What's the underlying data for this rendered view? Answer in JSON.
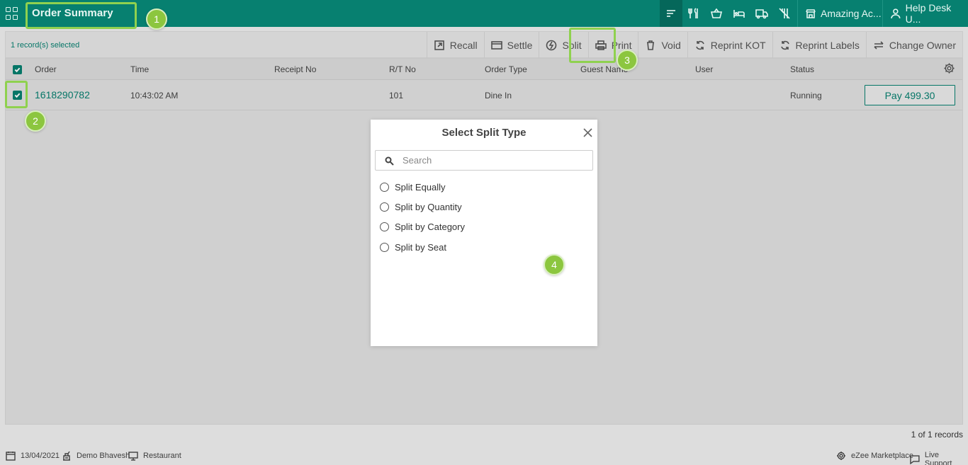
{
  "header": {
    "title": "Order Summary",
    "property_name": "Amazing Ac...",
    "user_name": "Help Desk U...",
    "icons": [
      "sort-icon",
      "restaurant-icon",
      "basket-icon",
      "bed-icon",
      "delivery-truck-icon",
      "no-service-icon"
    ]
  },
  "toolbar": {
    "selection_text": "1 record(s) selected",
    "actions": [
      {
        "label": "Recall",
        "icon": "recall-icon"
      },
      {
        "label": "Settle",
        "icon": "card-icon"
      },
      {
        "label": "Split",
        "icon": "split-icon"
      },
      {
        "label": "Print",
        "icon": "print-icon"
      },
      {
        "label": "Void",
        "icon": "trash-icon"
      },
      {
        "label": "Reprint KOT",
        "icon": "refresh-icon"
      },
      {
        "label": "Reprint Labels",
        "icon": "refresh-icon"
      },
      {
        "label": "Change Owner",
        "icon": "swap-icon"
      }
    ]
  },
  "table": {
    "columns": [
      "Order",
      "Time",
      "Receipt No",
      "R/T No",
      "Order Type",
      "Guest Name",
      "User",
      "Status"
    ],
    "rows": [
      {
        "order": "1618290782",
        "time": "10:43:02 AM",
        "receipt_no": "",
        "rt_no": "101",
        "order_type": "Dine In",
        "guest_name": "",
        "user": "",
        "status": "Running",
        "pay_label": "Pay 499.30",
        "selected": true
      }
    ],
    "records_text": "1 of 1 records"
  },
  "modal": {
    "title": "Select Split Type",
    "search_placeholder": "Search",
    "options": [
      "Split Equally",
      "Split by Quantity",
      "Split by Category",
      "Split by Seat"
    ]
  },
  "status_bar": {
    "date": "13/04/2021",
    "user": "Demo Bhavesh",
    "outlet": "Restaurant",
    "marketplace": "eZee Marketplace",
    "support": "Live Support"
  },
  "annotations": [
    "1",
    "2",
    "3",
    "4"
  ],
  "colors": {
    "primary": "#078070",
    "highlight": "#8fd14f",
    "badge": "#8cc63f"
  }
}
